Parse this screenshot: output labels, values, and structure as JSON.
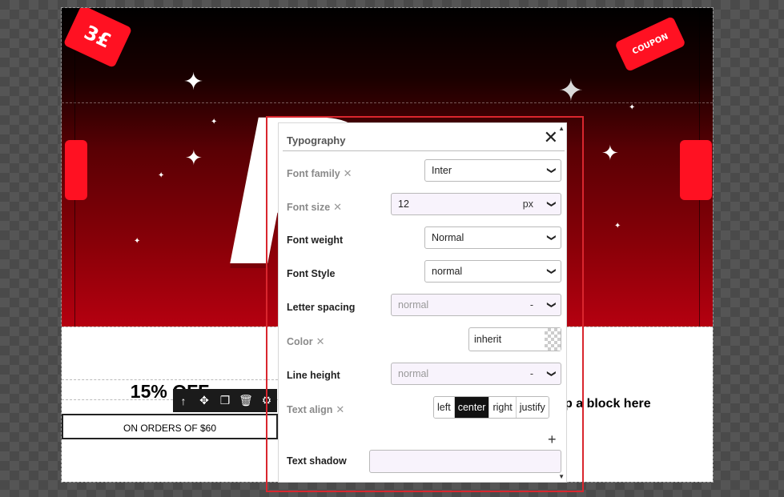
{
  "hero": {
    "ticket_left_text": "3£",
    "ticket_right_text": "COUPON",
    "headline_fragment": "P"
  },
  "offer": {
    "title": "15% OFF",
    "button_label": "ON ORDERS OF $60"
  },
  "drop_hint": "p a block here",
  "block_toolbar": {
    "icons": [
      "arrow-up-icon",
      "move-icon",
      "copy-icon",
      "trash-icon",
      "gear-icon"
    ]
  },
  "typography": {
    "title": "Typography",
    "font_family": {
      "label": "Font family",
      "value": "Inter"
    },
    "font_size": {
      "label": "Font size",
      "value": "12",
      "unit": "px"
    },
    "font_weight": {
      "label": "Font weight",
      "value": "Normal"
    },
    "font_style": {
      "label": "Font Style",
      "value": "normal"
    },
    "letter_spacing": {
      "label": "Letter spacing",
      "placeholder": "normal",
      "unit": "-"
    },
    "color": {
      "label": "Color",
      "value": "inherit"
    },
    "line_height": {
      "label": "Line height",
      "placeholder": "normal",
      "unit": "-"
    },
    "text_align": {
      "label": "Text align",
      "options": [
        "left",
        "center",
        "right",
        "justify"
      ],
      "selected": "center"
    },
    "text_shadow": {
      "label": "Text shadow"
    },
    "clear_symbol": "✕",
    "add_symbol": "+"
  },
  "colors": {
    "hero_red": "#b50010",
    "ticket_red": "#ff1122",
    "selection_frame": "#d9262e"
  }
}
